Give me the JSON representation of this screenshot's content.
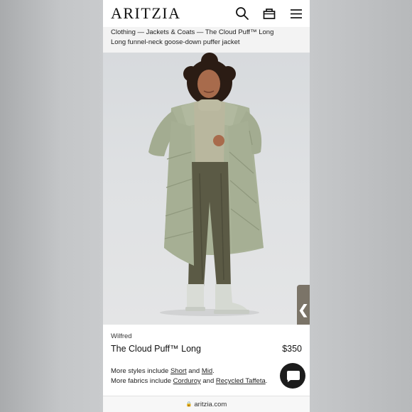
{
  "header": {
    "logo_text": "ARITZIA",
    "icons": [
      "search-icon",
      "bag-icon",
      "menu-icon"
    ]
  },
  "breadcrumb": {
    "items": [
      "Clothing",
      "Jackets & Coats",
      "The Cloud Puff™ Long"
    ],
    "separator": "—",
    "line1": "Clothing — Jackets & Coats — The Cloud Puff™ Long",
    "line2": "Long funnel-neck goose-down puffer jacket"
  },
  "side_tab": {
    "glyph": "❮"
  },
  "product": {
    "brand": "Wilfred",
    "name": "The Cloud Puff™ Long",
    "price": "$350"
  },
  "more_styles": {
    "prefix": "More styles include ",
    "link1": "Short",
    "mid": " and ",
    "link2": "Mid",
    "suffix": "."
  },
  "more_fabrics": {
    "prefix": "More fabrics include ",
    "link1": "Corduroy",
    "mid": " and ",
    "link2": "Recycled Taffeta",
    "suffix": "."
  },
  "url_bar": {
    "domain": "aritzia.com"
  },
  "colors": {
    "coat": "#a9b297",
    "pants": "#5b5a45",
    "side_tab": "#7b7468",
    "chat_button": "#1c1c1c"
  }
}
